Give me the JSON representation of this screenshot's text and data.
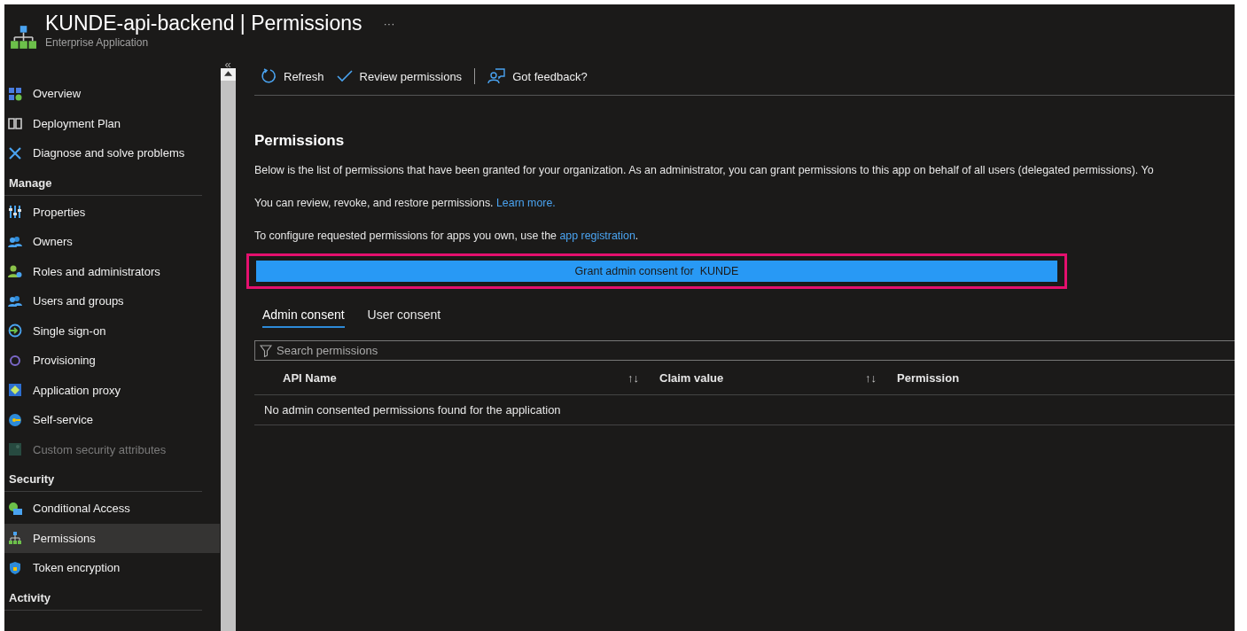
{
  "header": {
    "title": "KUNDE-api-backend",
    "separator": "|",
    "page": "Permissions",
    "more": "···",
    "subtitle": "Enterprise Application"
  },
  "sidebar": {
    "collapse": "«",
    "groups": [
      {
        "items": [
          {
            "label": "Overview",
            "selected": false,
            "disabled": false
          },
          {
            "label": "Deployment Plan",
            "selected": false,
            "disabled": false
          },
          {
            "label": "Diagnose and solve problems",
            "selected": false,
            "disabled": false
          }
        ]
      },
      {
        "heading": "Manage",
        "items": [
          {
            "label": "Properties",
            "selected": false,
            "disabled": false
          },
          {
            "label": "Owners",
            "selected": false,
            "disabled": false
          },
          {
            "label": "Roles and administrators",
            "selected": false,
            "disabled": false
          },
          {
            "label": "Users and groups",
            "selected": false,
            "disabled": false
          },
          {
            "label": "Single sign-on",
            "selected": false,
            "disabled": false
          },
          {
            "label": "Provisioning",
            "selected": false,
            "disabled": false
          },
          {
            "label": "Application proxy",
            "selected": false,
            "disabled": false
          },
          {
            "label": "Self-service",
            "selected": false,
            "disabled": false
          },
          {
            "label": "Custom security attributes",
            "selected": false,
            "disabled": true
          }
        ]
      },
      {
        "heading": "Security",
        "items": [
          {
            "label": "Conditional Access",
            "selected": false,
            "disabled": false
          },
          {
            "label": "Permissions",
            "selected": true,
            "disabled": false
          },
          {
            "label": "Token encryption",
            "selected": false,
            "disabled": false
          }
        ]
      },
      {
        "heading": "Activity"
      }
    ]
  },
  "toolbar": [
    "Refresh",
    "Review permissions",
    "Got feedback?"
  ],
  "content": {
    "heading": "Permissions",
    "paragraphs": [
      "Below is the list of permissions that have been granted for your organization. As an administrator, you can grant permissions to this app on behalf of all users (delegated permissions). Yo"
    ],
    "review": {
      "text": "You can review, revoke, and restore permissions.",
      "link": "Learn more."
    },
    "configure": {
      "text": "To configure requested permissions for apps you own, use the",
      "link": "app registration",
      "end": "."
    },
    "grant_button": {
      "label": "Grant admin consent for",
      "tenant": "KUNDE",
      "highlighted": true
    },
    "tabs": [
      {
        "label": "Admin consent",
        "selected": true
      },
      {
        "label": "User consent",
        "selected": false
      }
    ],
    "search": {
      "placeholder": "Search permissions"
    },
    "table": {
      "columns": [
        {
          "label": "API Name",
          "sort": "↑↓"
        },
        {
          "label": "Claim value",
          "sort": "↑↓"
        },
        {
          "label": "Permission"
        }
      ],
      "empty": "No admin consented permissions found for the application"
    }
  }
}
